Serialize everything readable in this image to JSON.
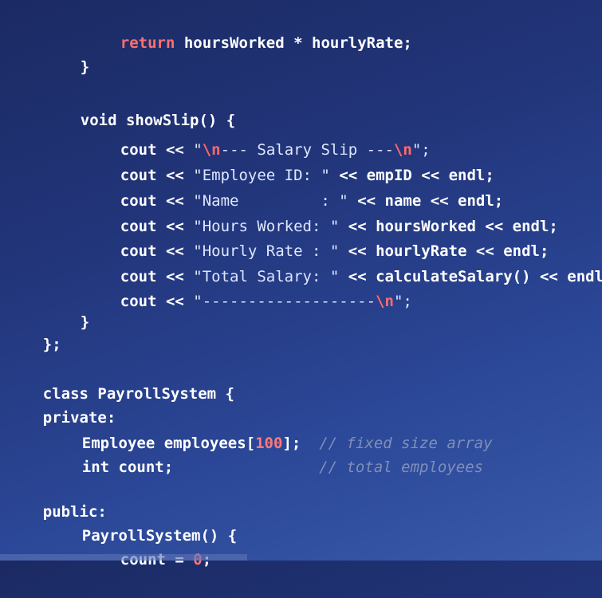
{
  "lines": {
    "l1": {
      "t1": "return",
      "t2": " hoursWorked ",
      "t3": "*",
      "t4": " hourlyRate;"
    },
    "l2": {
      "t1": "}"
    },
    "l3": {
      "t1": "void showSlip() {"
    },
    "l4": {
      "t1": "cout << ",
      "t2": "\"",
      "t3": "\\n",
      "t4": "--- Salary Slip ---",
      "t5": "\\n",
      "t6": "\";"
    },
    "l5": {
      "t1": "cout << ",
      "t2": "\"Employee ID: \"",
      "t3": " << empID << endl;"
    },
    "l6": {
      "t1": "cout << ",
      "t2": "\"Name         : \"",
      "t3": " << name << endl;"
    },
    "l7": {
      "t1": "cout << ",
      "t2": "\"Hours Worked: \"",
      "t3": " << hoursWorked << endl;"
    },
    "l8": {
      "t1": "cout << ",
      "t2": "\"Hourly Rate : \"",
      "t3": " << hourlyRate << endl;"
    },
    "l9": {
      "t1": "cout << ",
      "t2": "\"Total Salary: \"",
      "t3": " << calculateSalary() << endl;"
    },
    "l10": {
      "t1": "cout << ",
      "t2": "\"-------------------",
      "t3": "\\n",
      "t4": "\";"
    },
    "l11": {
      "t1": "}"
    },
    "l12": {
      "t1": "};"
    },
    "l13": {
      "t1": "class PayrollSystem {"
    },
    "l14": {
      "t1": "private:"
    },
    "l15": {
      "t1": "Employee employees[",
      "t2": "100",
      "t3": "];",
      "t4": "  // fixed size array"
    },
    "l16": {
      "t1": "int count;",
      "t2": "                // total employees"
    },
    "l17": {
      "t1": "public:"
    },
    "l18": {
      "t1": "PayrollSystem() {"
    },
    "l19": {
      "t1": "count = ",
      "t2": "0",
      "t3": ";"
    }
  }
}
